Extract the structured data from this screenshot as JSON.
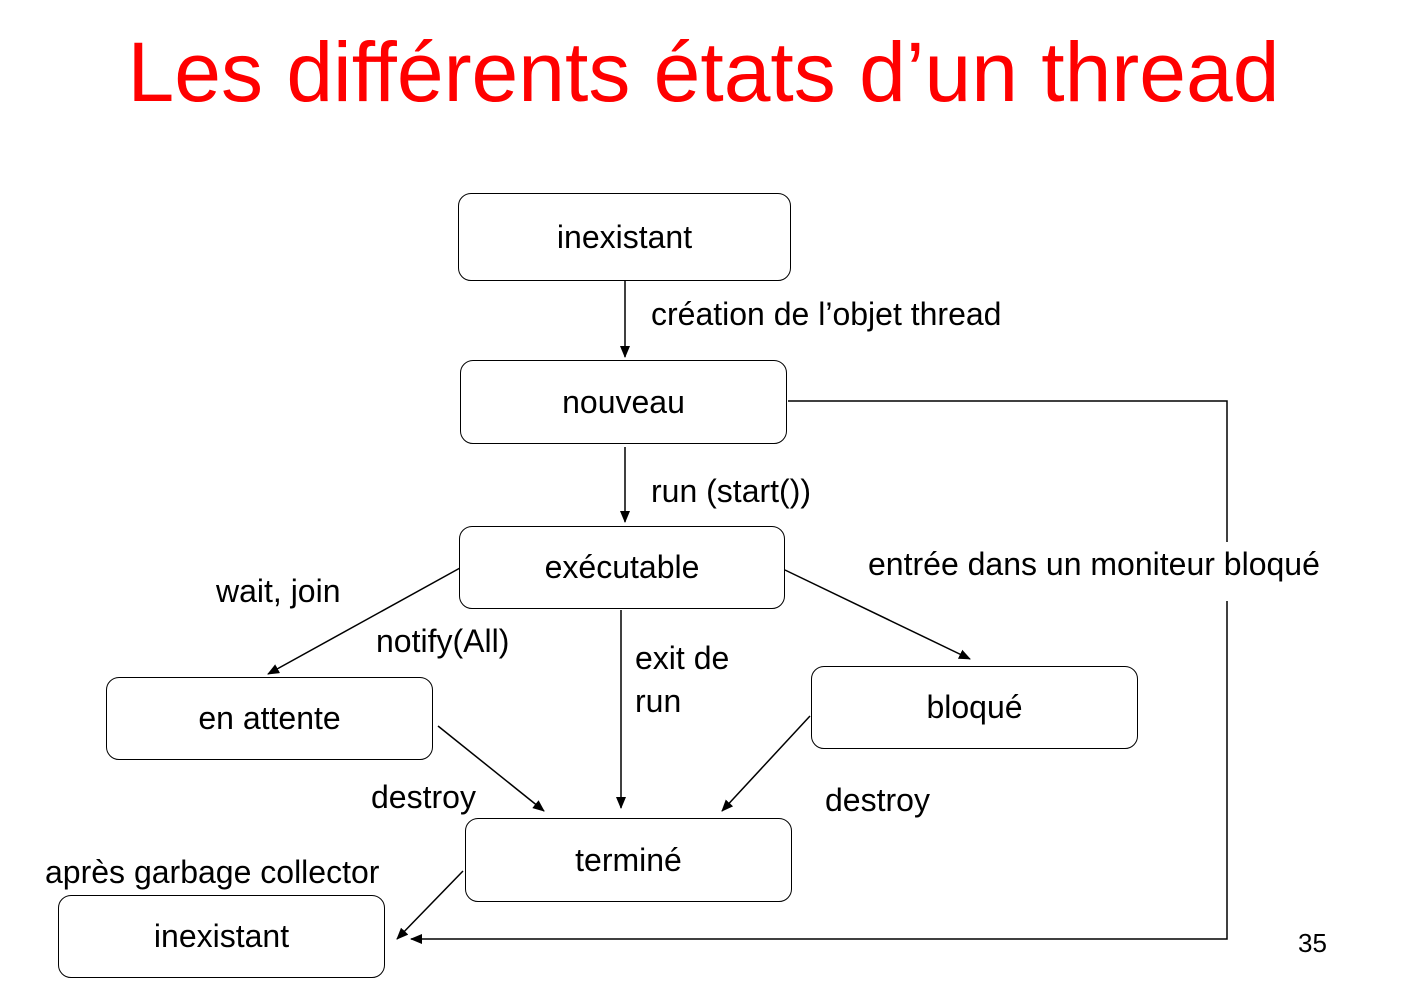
{
  "slide": {
    "title": "Les différents états d’un thread",
    "title_color": "#ff0000",
    "page_number": "35"
  },
  "states": {
    "inexistant_top": "inexistant",
    "nouveau": "nouveau",
    "executable": "exécutable",
    "en_attente": "en attente",
    "bloque": "bloqué",
    "termine": "terminé",
    "inexistant_bottom": "inexistant"
  },
  "transitions": {
    "creation": "création de l’objet thread",
    "run_start": "run (start())",
    "moniteur_bloque": "entrée dans un moniteur bloqué",
    "wait_join": "wait, join",
    "notify_all": "notify(All)",
    "exit_de_run_line1": "exit de",
    "exit_de_run_line2": "run",
    "destroy_left": "destroy",
    "destroy_right": "destroy",
    "garbage_collector": "après garbage collector"
  }
}
